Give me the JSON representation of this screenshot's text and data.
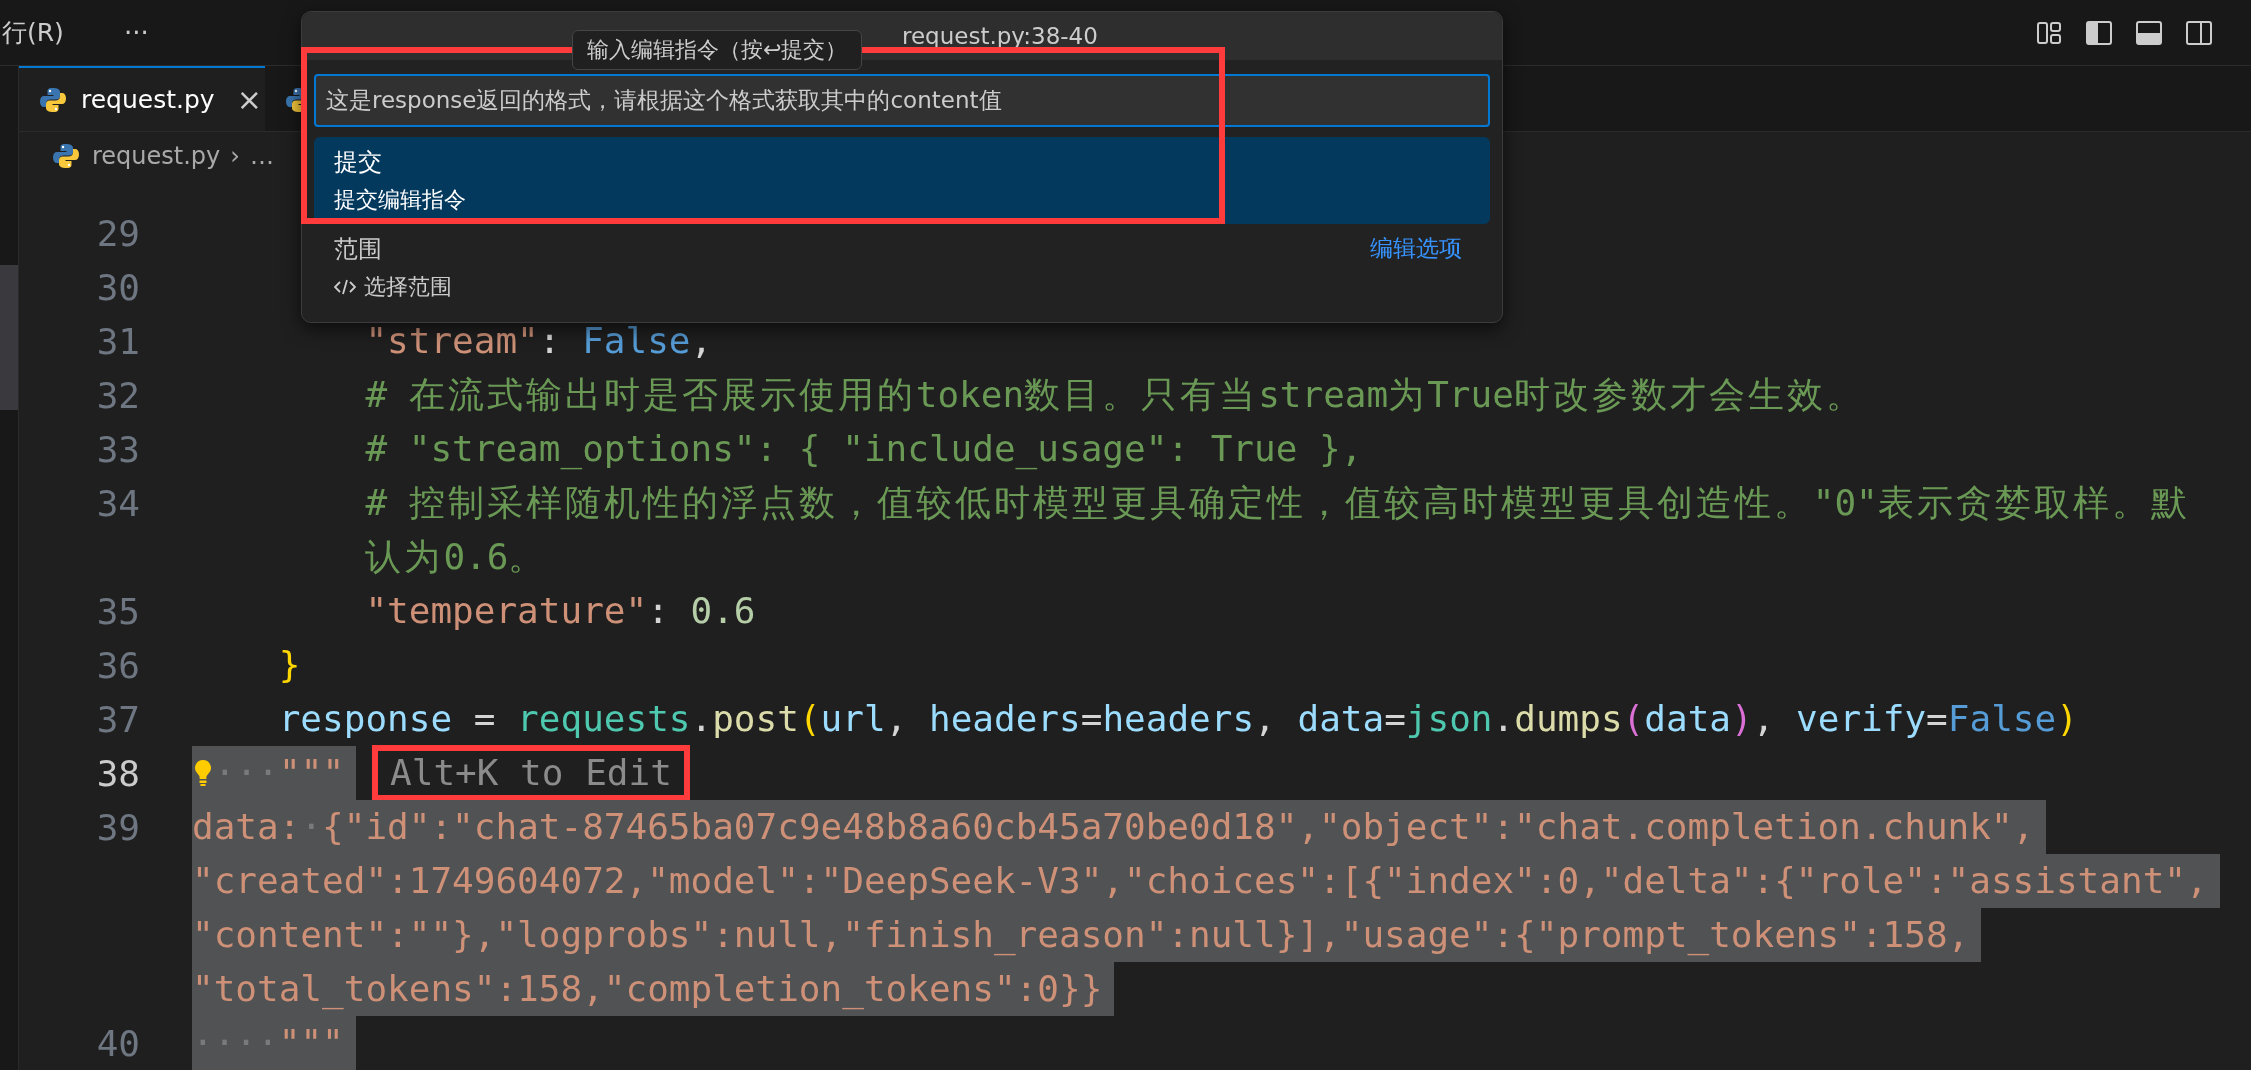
{
  "menu_bar": {
    "items": [
      "行(R)"
    ],
    "more": "···"
  },
  "layout_controls": [
    {
      "kind": "layout",
      "on": false
    },
    {
      "kind": "sidebar_left",
      "on": true
    },
    {
      "kind": "panel",
      "on": true
    },
    {
      "kind": "sidebar_right",
      "on": false
    }
  ],
  "tabs": [
    {
      "label": "request.py",
      "close": "×",
      "selected": true
    },
    {
      "selected": false
    }
  ],
  "breadcrumb": [
    {
      "kind": "file",
      "label": "request.py"
    },
    {
      "kind": "separator",
      "label": "›"
    },
    {
      "kind": "symbol",
      "label": "…"
    }
  ],
  "editor": {
    "rows": [
      {
        "kind": "flat",
        "number": "29",
        "active": false
      },
      {
        "kind": "flat",
        "number": "30",
        "active": false
      },
      {
        "kind": "deep",
        "number": "31",
        "active": false,
        "selected": false,
        "tokens": [
          {
            "kind": "string",
            "text": "\"stream\""
          },
          {
            "kind": "plain",
            "text": ": "
          },
          {
            "kind": "keyword",
            "text": "False"
          },
          {
            "kind": "plain",
            "text": ","
          }
        ]
      },
      {
        "kind": "deep",
        "number": "32",
        "active": false,
        "selected": false,
        "tokens": [
          {
            "kind": "comment",
            "text": "# 在流式输出时是否展示使用的token数目。只有当stream为True时改参数才会生效。"
          }
        ]
      },
      {
        "kind": "deep",
        "number": "33",
        "active": false,
        "selected": false,
        "tokens": [
          {
            "kind": "comment",
            "text": "# \"stream_options\": { \"include_usage\": True },"
          }
        ]
      },
      {
        "kind": "deep",
        "number": "34",
        "active": false,
        "selected": false,
        "tokens": [
          {
            "kind": "comment",
            "text": "# 控制采样随机性的浮点数，值较低时模型更具确定性，值较高时模型更具创造性。\"0\"表示贪婪取样。默"
          }
        ]
      },
      {
        "kind": "deep",
        "selected": false,
        "tokens": [
          {
            "kind": "comment",
            "text": "认为0.6。"
          }
        ]
      },
      {
        "kind": "deep",
        "number": "35",
        "active": false,
        "selected": false,
        "tokens": [
          {
            "kind": "string",
            "text": "\"temperature\""
          },
          {
            "kind": "plain",
            "text": ": "
          },
          {
            "kind": "number",
            "text": "0.6"
          }
        ]
      },
      {
        "kind": "inner",
        "number": "36",
        "active": false,
        "selected": false,
        "tokens": [
          {
            "kind": "bracket1",
            "text": "}"
          }
        ]
      },
      {
        "kind": "inner",
        "number": "37",
        "active": false,
        "selected": false,
        "tokens": [
          {
            "kind": "variable",
            "text": "response"
          },
          {
            "kind": "plain",
            "text": " = "
          },
          {
            "kind": "module",
            "text": "requests"
          },
          {
            "kind": "plain",
            "text": "."
          },
          {
            "kind": "function",
            "text": "post"
          },
          {
            "kind": "bracket1",
            "text": "("
          },
          {
            "kind": "variable",
            "text": "url"
          },
          {
            "kind": "plain",
            "text": ", "
          },
          {
            "kind": "variable",
            "text": "headers"
          },
          {
            "kind": "plain",
            "text": "="
          },
          {
            "kind": "variable",
            "text": "headers"
          },
          {
            "kind": "plain",
            "text": ", "
          },
          {
            "kind": "variable",
            "text": "data"
          },
          {
            "kind": "plain",
            "text": "="
          },
          {
            "kind": "module",
            "text": "json"
          },
          {
            "kind": "plain",
            "text": "."
          },
          {
            "kind": "function",
            "text": "dumps"
          },
          {
            "kind": "bracket2",
            "text": "("
          },
          {
            "kind": "variable",
            "text": "data"
          },
          {
            "kind": "bracket2",
            "text": ")"
          },
          {
            "kind": "plain",
            "text": ", "
          },
          {
            "kind": "variable",
            "text": "verify"
          },
          {
            "kind": "plain",
            "text": "="
          },
          {
            "kind": "keyword",
            "text": "False"
          },
          {
            "kind": "bracket1",
            "text": ")"
          }
        ]
      },
      {
        "kind": "flat",
        "number": "38",
        "active": true,
        "selected": true,
        "lightbulb": true,
        "tokens": [
          {
            "kind": "whitespace",
            "text": "···"
          },
          {
            "kind": "string",
            "text": "\"\"\""
          }
        ],
        "hint": {
          "text": "Alt+K to Edit",
          "highlighted": true
        }
      },
      {
        "kind": "flat",
        "number": "39",
        "active": false,
        "selected": true,
        "tokens": [
          {
            "kind": "string",
            "text": "data:"
          },
          {
            "kind": "whitespace",
            "text": "·"
          },
          {
            "kind": "string",
            "text": "{\"id\":\"chat-87465ba07c9e48b8a60cb45a70be0d18\",\"object\":\"chat.completion.chunk\","
          }
        ]
      },
      {
        "kind": "flat",
        "selected": true,
        "tokens": [
          {
            "kind": "string",
            "text": "\"created\":1749604072,\"model\":\"DeepSeek-V3\",\"choices\":[{\"index\":0,\"delta\":{\"role\":\"assistant\","
          }
        ]
      },
      {
        "kind": "flat",
        "selected": true,
        "tokens": [
          {
            "kind": "string",
            "text": "\"content\":\"\"},\"logprobs\":null,\"finish_reason\":null}],\"usage\":{\"prompt_tokens\":158,"
          }
        ]
      },
      {
        "kind": "flat",
        "selected": true,
        "tokens": [
          {
            "kind": "string",
            "text": "\"total_tokens\":158,\"completion_tokens\":0}}"
          }
        ]
      },
      {
        "kind": "flat",
        "number": "40",
        "active": false,
        "selected": true,
        "tokens": [
          {
            "kind": "whitespace",
            "text": "····"
          },
          {
            "kind": "string",
            "text": "\"\"\""
          }
        ]
      }
    ]
  },
  "quick_input": {
    "title": "request.py:38-40",
    "tooltip": "输入编辑指令（按↩提交）",
    "value": "这是response返回的格式，请根据这个格式获取其中的content值",
    "highlighted": true,
    "items": [
      {
        "kind": "command",
        "label": "提交",
        "description": "提交编辑指令",
        "selected": true
      },
      {
        "kind": "range",
        "label": "范围",
        "description": "选择范围",
        "action": "编辑选项",
        "selected": false
      }
    ]
  }
}
